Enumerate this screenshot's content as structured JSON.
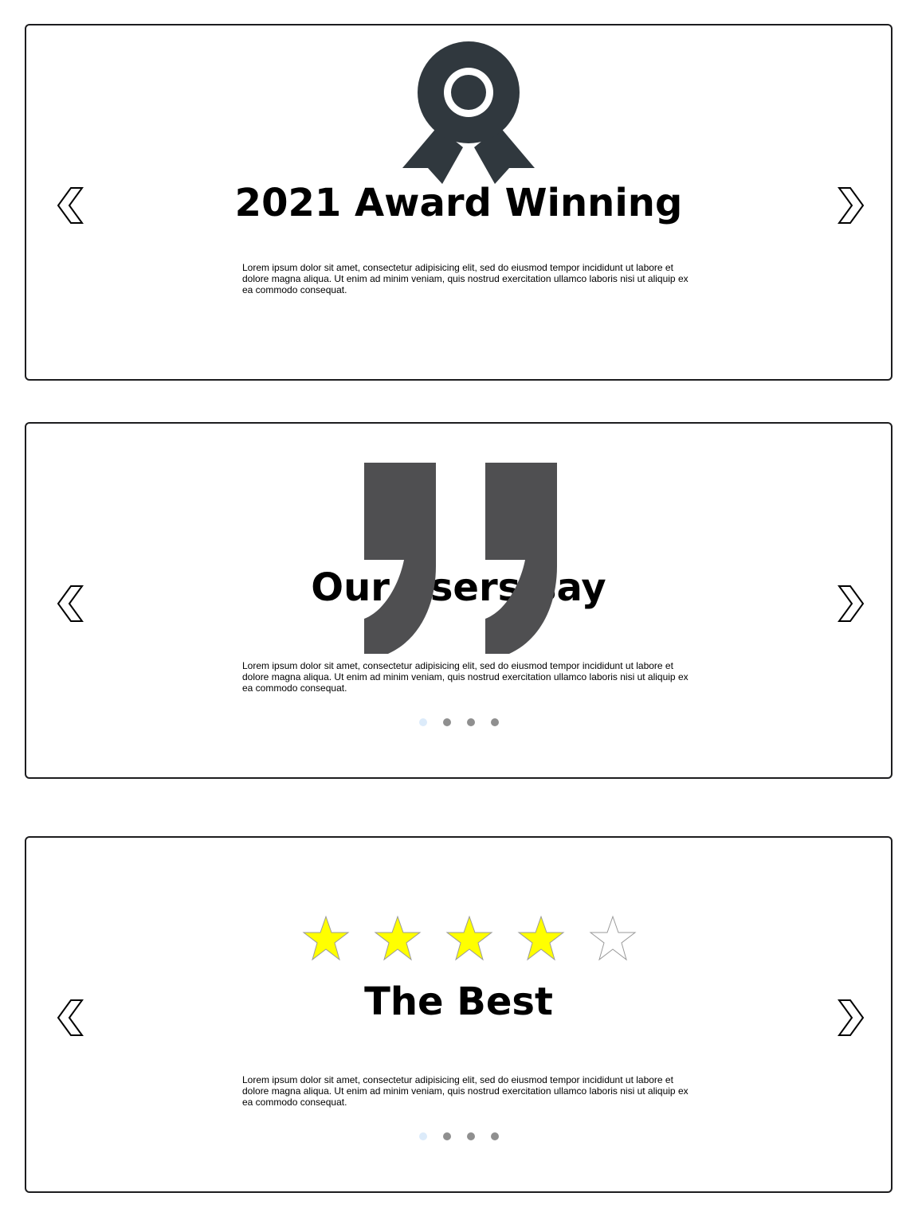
{
  "colors": {
    "star_filled": "#ffff00",
    "star_empty": "#ffffff",
    "icon_dark": "#30383e",
    "quote": "#4f4f51",
    "dot_active": "#dcebfa",
    "dot_inactive": "#8f8f8f"
  },
  "icons": {
    "prev": "chevron-left-icon",
    "next": "chevron-right-icon",
    "award": "award-ribbon-icon",
    "quote": "quote-icon",
    "star": "star-icon"
  },
  "cards": [
    {
      "title": "2021 Award Winning",
      "body": "Lorem ipsum dolor sit amet, consectetur adipisicing elit, sed do eiusmod tempor incididunt ut labore et dolore magna aliqua. Ut enim ad minim veniam, quis nostrud exercitation ullamco laboris nisi ut aliquip ex ea commodo consequat."
    },
    {
      "title": "Our users say",
      "body": "Lorem ipsum dolor sit amet, consectetur adipisicing elit, sed do eiusmod tempor incididunt ut labore et dolore magna aliqua. Ut enim ad minim veniam, quis nostrud exercitation ullamco laboris nisi ut aliquip ex ea commodo consequat.",
      "dots": {
        "count": 4,
        "active_index": 0
      }
    },
    {
      "title": "The Best",
      "body": "Lorem ipsum dolor sit amet, consectetur adipisicing elit, sed do eiusmod tempor incididunt ut labore et dolore magna aliqua. Ut enim ad minim veniam, quis nostrud exercitation ullamco laboris nisi ut aliquip ex ea commodo consequat.",
      "rating": {
        "value": 4,
        "max": 5
      },
      "dots": {
        "count": 4,
        "active_index": 0
      }
    }
  ]
}
